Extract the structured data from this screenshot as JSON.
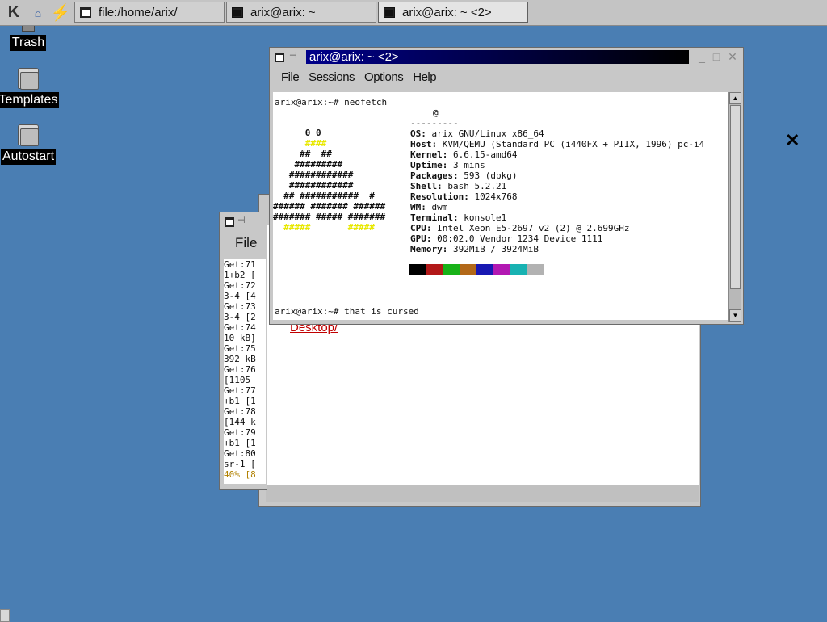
{
  "taskbar": {
    "tasks": [
      {
        "label": "file:/home/arix/",
        "icon": "window-icon"
      },
      {
        "label": "arix@arix: ~",
        "icon": "terminal-icon"
      },
      {
        "label": "arix@arix: ~ <2>",
        "icon": "terminal-icon"
      }
    ]
  },
  "desktop": {
    "icons": [
      {
        "label": "Trash",
        "icon": "trash-icon"
      },
      {
        "label": "Templates",
        "icon": "folder-icon"
      },
      {
        "label": "Autostart",
        "icon": "folder-icon"
      }
    ]
  },
  "konqueror": {
    "link": "Desktop/"
  },
  "log_window": {
    "menu": "File",
    "lines": [
      "Get:71",
      "1+b2 [",
      "Get:72",
      "3-4 [4",
      "Get:73",
      "3-4 [2",
      "Get:74",
      "10 kB]",
      "Get:75",
      "392 kB",
      "Get:76",
      "[1105",
      "Get:77",
      "+b1 [1",
      "Get:78",
      "[144 k",
      "Get:79",
      "+b1 [1",
      "Get:80",
      "sr-1 ["
    ],
    "progress": "40% [8"
  },
  "konsole": {
    "title": "arix@arix: ~ <2>",
    "menu": [
      "File",
      "Sessions",
      "Options",
      "Help"
    ],
    "prompt1": "arix@arix:~# neofetch",
    "user_host": "@",
    "separator": "---------",
    "info": [
      {
        "key": "OS:",
        "value": " arix GNU/Linux x86_64"
      },
      {
        "key": "Host:",
        "value": " KVM/QEMU (Standard PC (i440FX + PIIX, 1996) pc-i4"
      },
      {
        "key": "Kernel:",
        "value": " 6.6.15-amd64"
      },
      {
        "key": "Uptime:",
        "value": " 3 mins"
      },
      {
        "key": "Packages:",
        "value": " 593 (dpkg)"
      },
      {
        "key": "Shell:",
        "value": " bash 5.2.21"
      },
      {
        "key": "Resolution:",
        "value": " 1024x768"
      },
      {
        "key": "WM:",
        "value": " dwm"
      },
      {
        "key": "Terminal:",
        "value": " konsole1"
      },
      {
        "key": "CPU:",
        "value": " Intel Xeon E5-2697 v2 (2) @ 2.699GHz"
      },
      {
        "key": "GPU:",
        "value": " 00:02.0 Vendor 1234 Device 1111"
      },
      {
        "key": "Memory:",
        "value": " 392MiB / 3924MiB"
      }
    ],
    "logo": [
      {
        "text": "      0 0",
        "color": "dark"
      },
      {
        "text": "      ####",
        "color": "yellow"
      },
      {
        "text": "     ##  ##",
        "color": "mixed"
      },
      {
        "text": "    #########",
        "color": "dark"
      },
      {
        "text": "   ############",
        "color": "dark"
      },
      {
        "text": "   ############",
        "color": "dark"
      },
      {
        "text": "  ## ###########  #",
        "color": "mixed"
      },
      {
        "text": "###### ####### ######",
        "color": "mixed"
      },
      {
        "text": "####### ##### #######",
        "color": "mixed"
      },
      {
        "text": "  #####       #####",
        "color": "yellow"
      }
    ],
    "palette": [
      "#000000",
      "#b21818",
      "#18b218",
      "#b26818",
      "#1818b2",
      "#b218b2",
      "#18b2b2",
      "#b2b2b2"
    ],
    "prompt2": "arix@arix:~# that is cursed"
  },
  "desktop_close_glyph": "✕"
}
